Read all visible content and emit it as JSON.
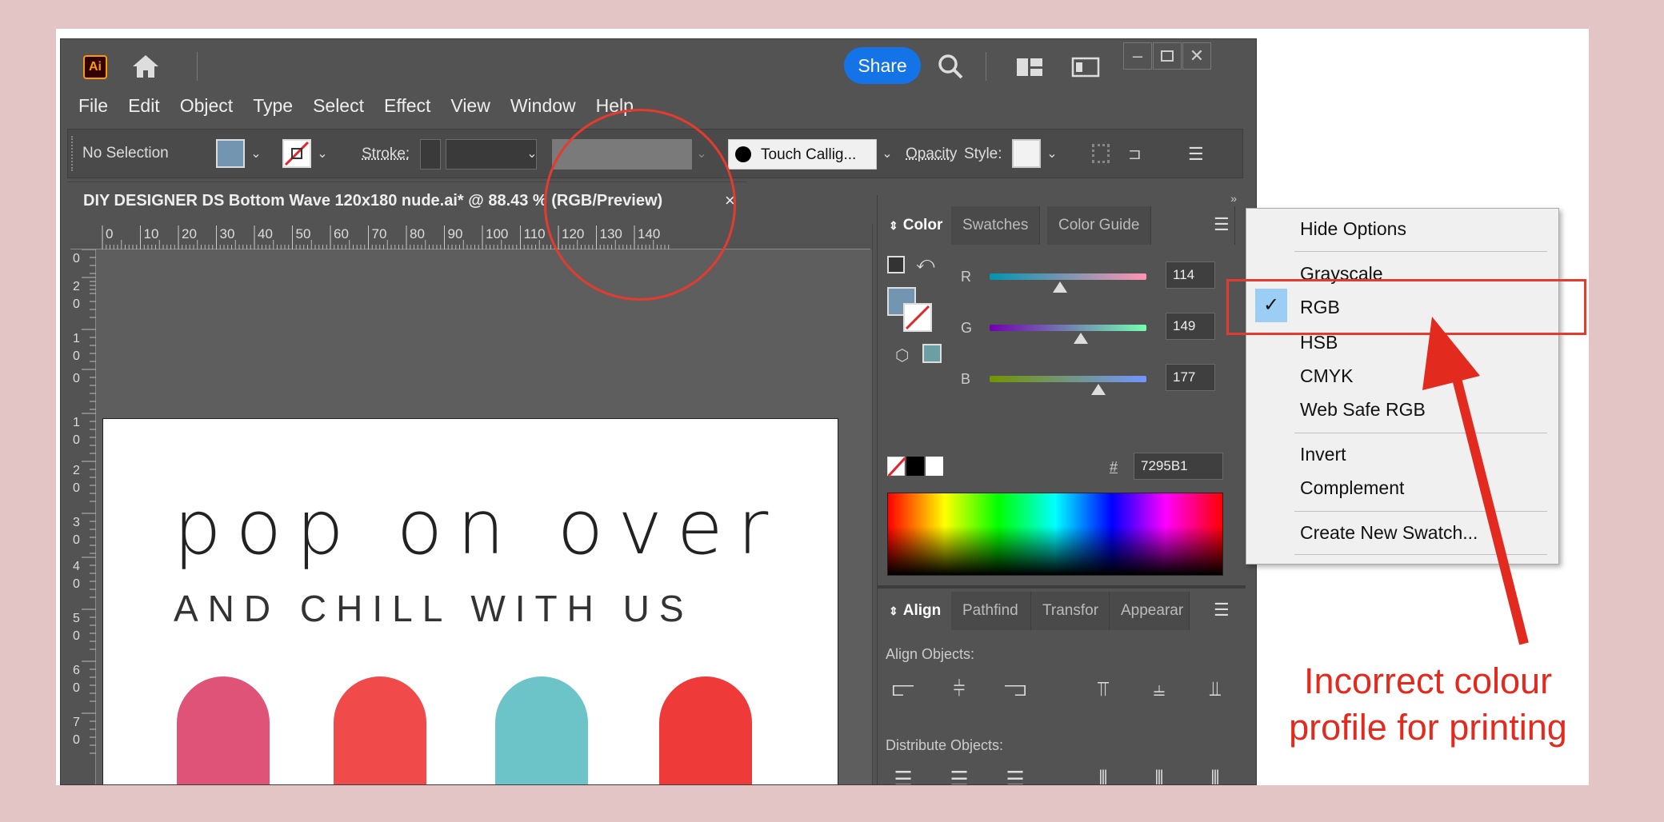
{
  "app": {
    "logo": "Ai",
    "share_label": "Share"
  },
  "menu": [
    "File",
    "Edit",
    "Object",
    "Type",
    "Select",
    "Effect",
    "View",
    "Window",
    "Help"
  ],
  "control_bar": {
    "selection": "No Selection",
    "stroke_label": "Stroke:",
    "brush": "Touch Callig...",
    "opacity_label": "Opacity",
    "style_label": "Style:"
  },
  "document": {
    "tab_title": "DIY DESIGNER DS Bottom Wave 120x180 nude.ai* @ 88.43 % (RGB/Preview)",
    "close": "×"
  },
  "ruler": {
    "h_ticks": [
      "0",
      "10",
      "20",
      "30",
      "40",
      "50",
      "60",
      "70",
      "80",
      "90",
      "100",
      "110",
      "120",
      "130",
      "140"
    ],
    "v_ticks": [
      [
        "0"
      ],
      [
        "2",
        "0"
      ],
      [
        "1",
        "0"
      ],
      [
        "0"
      ],
      [
        "1",
        "0"
      ],
      [
        "2",
        "0"
      ],
      [
        "3",
        "0"
      ],
      [
        "4",
        "0"
      ],
      [
        "5",
        "0"
      ],
      [
        "6",
        "0"
      ],
      [
        "7",
        "0"
      ]
    ]
  },
  "artboard": {
    "headline": "pop on over",
    "subheadline": "AND CHILL WITH US",
    "popsicle_colors": [
      "#e05378",
      "#f04a4a",
      "#6cc3c8",
      "#ef3a3a"
    ]
  },
  "color_panel": {
    "tabs": [
      "Color",
      "Swatches",
      "Color Guide"
    ],
    "channels": [
      {
        "label": "R",
        "value": "114",
        "fraction": 0.447
      },
      {
        "label": "G",
        "value": "149",
        "fraction": 0.584
      },
      {
        "label": "B",
        "value": "177",
        "fraction": 0.694
      }
    ],
    "hex_label": "#",
    "hex_value": "7295B1",
    "fill_color": "#7295b1",
    "stroke_color": "#6b9fa3"
  },
  "align_panel": {
    "tabs": [
      "Align",
      "Pathfind",
      "Transfor",
      "Appearar"
    ],
    "align_label": "Align Objects:",
    "distribute_label": "Distribute Objects:"
  },
  "flyout_menu": {
    "items": [
      "Hide Options",
      "Grayscale",
      "RGB",
      "HSB",
      "CMYK",
      "Web Safe RGB",
      "Invert",
      "Complement",
      "Create New Swatch..."
    ],
    "checked": "RGB",
    "check_mark": "✓"
  },
  "annotation": {
    "note": "Incorrect colour profile for printing",
    "color": "#e22a1f"
  }
}
